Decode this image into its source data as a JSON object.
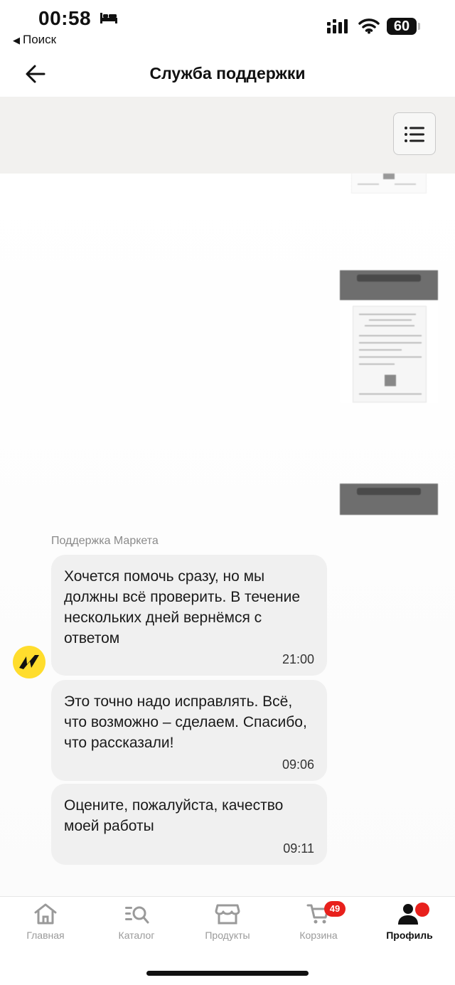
{
  "status_bar": {
    "time": "00:58",
    "back_app_label": "Поиск",
    "battery": "60"
  },
  "header": {
    "title": "Служба поддержки"
  },
  "chat": {
    "sender_name": "Поддержка Маркета",
    "messages": [
      {
        "text": "Хочется помочь сразу, но мы должны всё проверить. В течение нескольких дней вернёмся с ответом",
        "time": "21:00"
      },
      {
        "text": "Это точно надо исправлять. Всё, что возможно – сделаем. Спасибо, что рассказали!",
        "time": "09:06"
      },
      {
        "text": "Оцените, пожалуйста, качество моей работы",
        "time": "09:11"
      }
    ]
  },
  "bottom_nav": {
    "items": [
      {
        "label": "Главная",
        "icon": "home-icon"
      },
      {
        "label": "Каталог",
        "icon": "catalog-search-icon"
      },
      {
        "label": "Продукты",
        "icon": "store-icon"
      },
      {
        "label": "Корзина",
        "icon": "cart-icon",
        "badge": "49"
      },
      {
        "label": "Профиль",
        "icon": "profile-icon",
        "active": true
      }
    ]
  },
  "colors": {
    "accent_yellow": "#ffdd2d",
    "badge_red": "#e8201c",
    "bubble_bg": "#f0f0f0",
    "band_bg": "#f2f1ef"
  }
}
